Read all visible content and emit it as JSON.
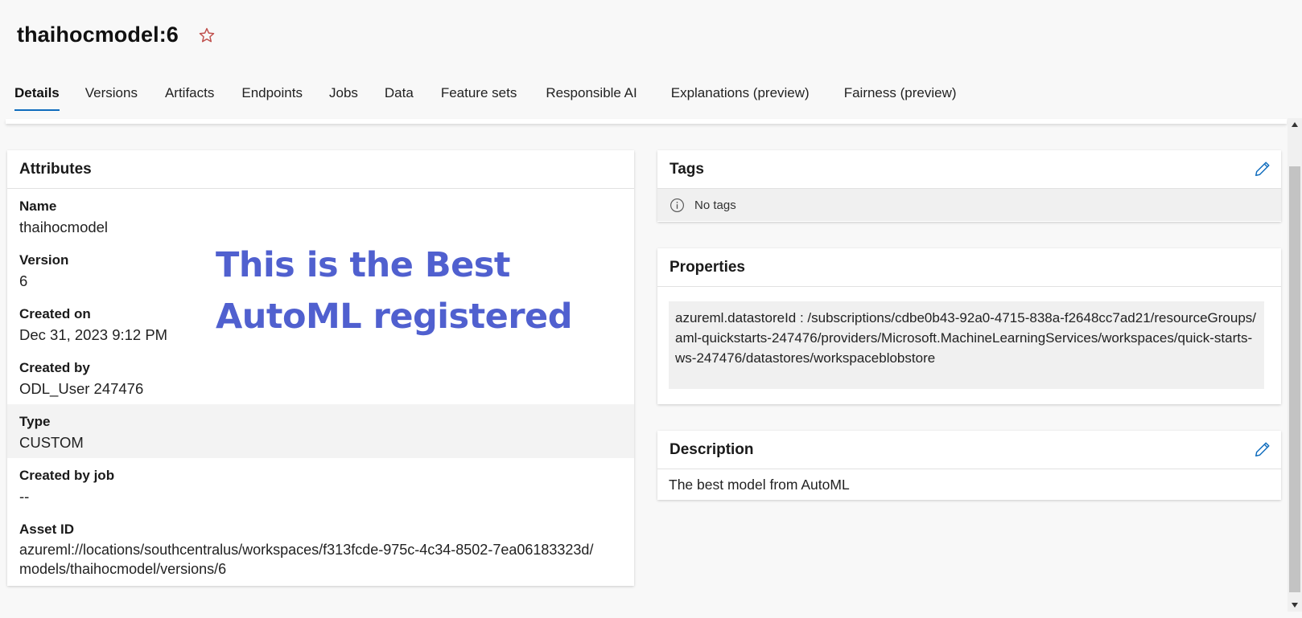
{
  "header": {
    "title": "thaihocmodel:6",
    "star_icon": "star-outline-icon"
  },
  "tabs": [
    {
      "label": "Details",
      "active": true
    },
    {
      "label": "Versions"
    },
    {
      "label": "Artifacts"
    },
    {
      "label": "Endpoints"
    },
    {
      "label": "Jobs"
    },
    {
      "label": "Data"
    },
    {
      "label": "Feature sets"
    },
    {
      "label": "Responsible AI"
    },
    {
      "label": "Explanations (preview)"
    },
    {
      "label": "Fairness (preview)"
    }
  ],
  "attributes": {
    "title": "Attributes",
    "items": [
      {
        "label": "Name",
        "value": "thaihocmodel"
      },
      {
        "label": "Version",
        "value": "6"
      },
      {
        "label": "Created on",
        "value": "Dec 31, 2023 9:12 PM"
      },
      {
        "label": "Created by",
        "value": "ODL_User 247476"
      },
      {
        "label": "Type",
        "value": "CUSTOM"
      },
      {
        "label": "Created by job",
        "value": "--"
      },
      {
        "label": "Asset ID",
        "value": "azureml://locations/southcentralus/workspaces/f313fcde-975c-4c34-8502-7ea06183323d/models/thaihocmodel/versions/6"
      }
    ]
  },
  "overlay_annotation": "This is the Best AutoML registered",
  "tags": {
    "title": "Tags",
    "empty_text": "No tags"
  },
  "properties": {
    "title": "Properties",
    "text": "azureml.datastoreId : /subscriptions/cdbe0b43-92a0-4715-838a-f2648cc7ad21/resourceGroups/aml-quickstarts-247476/providers/Microsoft.MachineLearningServices/workspaces/quick-starts-ws-247476/datastores/workspaceblobstore"
  },
  "description": {
    "title": "Description",
    "text": "The best model from AutoML"
  },
  "colors": {
    "accent": "#0f6cbd",
    "overlay_text": "#5060cf",
    "star": "#c0504d"
  }
}
